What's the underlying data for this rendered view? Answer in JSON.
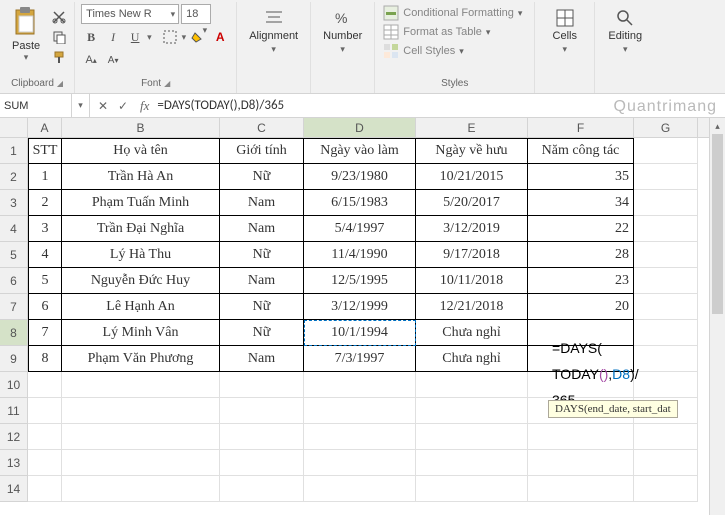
{
  "ribbon": {
    "clipboard": {
      "label": "Clipboard",
      "paste": "Paste"
    },
    "font": {
      "label": "Font",
      "name": "Times New R",
      "size": "18",
      "bold": "B",
      "italic": "I",
      "underline": "U"
    },
    "alignment": {
      "label": "Alignment"
    },
    "number": {
      "label": "Number"
    },
    "styles": {
      "label": "Styles",
      "conditional": "Conditional Formatting",
      "table": "Format as Table",
      "cellstyles": "Cell Styles"
    },
    "cells": {
      "label": "Cells"
    },
    "editing": {
      "label": "Editing"
    }
  },
  "namebox": "SUM",
  "formula": "=DAYS(TODAY(),D8)/365",
  "columns": [
    "A",
    "B",
    "C",
    "D",
    "E",
    "F",
    "G"
  ],
  "rownums": [
    "1",
    "2",
    "3",
    "4",
    "5",
    "6",
    "7",
    "8",
    "9",
    "10",
    "11",
    "12",
    "13",
    "14"
  ],
  "header_row": {
    "A": "STT",
    "B": "Họ và tên",
    "C": "Giới tính",
    "D": "Ngày vào làm",
    "E": "Ngày về hưu",
    "F": "Năm công tác"
  },
  "rows": [
    {
      "A": "1",
      "B": "Trần Hà An",
      "C": "Nữ",
      "D": "9/23/1980",
      "E": "10/21/2015",
      "F": "35"
    },
    {
      "A": "2",
      "B": "Phạm Tuấn Minh",
      "C": "Nam",
      "D": "6/15/1983",
      "E": "5/20/2017",
      "F": "34"
    },
    {
      "A": "3",
      "B": "Trần Đại Nghĩa",
      "C": "Nam",
      "D": "5/4/1997",
      "E": "3/12/2019",
      "F": "22"
    },
    {
      "A": "4",
      "B": "Lý Hà Thu",
      "C": "Nữ",
      "D": "11/4/1990",
      "E": "9/17/2018",
      "F": "28"
    },
    {
      "A": "5",
      "B": "Nguyễn Đức Huy",
      "C": "Nam",
      "D": "12/5/1995",
      "E": "10/11/2018",
      "F": "23"
    },
    {
      "A": "6",
      "B": "Lê Hạnh An",
      "C": "Nữ",
      "D": "3/12/1999",
      "E": "12/21/2018",
      "F": "20"
    },
    {
      "A": "7",
      "B": "Lý Minh Vân",
      "C": "Nữ",
      "D": "10/1/1994",
      "E": "Chưa nghỉ",
      "F": ""
    },
    {
      "A": "8",
      "B": "Phạm Văn Phương",
      "C": "Nam",
      "D": "7/3/1997",
      "E": "Chưa nghỉ",
      "F": ""
    }
  ],
  "formula_display": {
    "eq": "=",
    "fn1": "DAYS",
    "p1": "(",
    "fn2": "TODAY",
    "p2": "()",
    "comma": ",",
    "ref": "D8",
    "p3": ")/",
    "num": "365"
  },
  "tooltip": "DAYS(end_date, start_dat",
  "watermark": "Quantrimang"
}
